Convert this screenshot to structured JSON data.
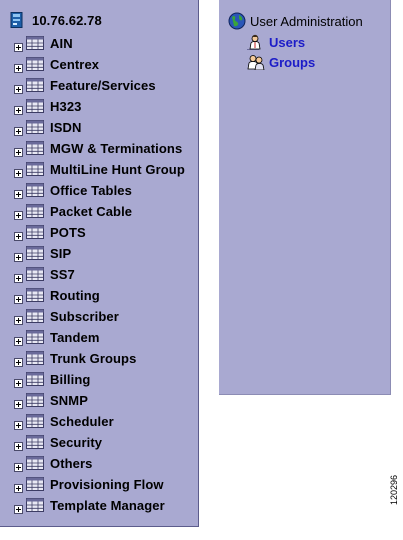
{
  "tree": {
    "root_label": "10.76.62.78",
    "items": [
      {
        "label": "AIN"
      },
      {
        "label": "Centrex"
      },
      {
        "label": "Feature/Services"
      },
      {
        "label": "H323"
      },
      {
        "label": "ISDN"
      },
      {
        "label": "MGW & Terminations"
      },
      {
        "label": "MultiLine Hunt Group"
      },
      {
        "label": "Office Tables"
      },
      {
        "label": "Packet Cable"
      },
      {
        "label": "POTS"
      },
      {
        "label": "SIP"
      },
      {
        "label": "SS7"
      },
      {
        "label": "Routing"
      },
      {
        "label": "Subscriber"
      },
      {
        "label": "Tandem"
      },
      {
        "label": "Trunk Groups"
      },
      {
        "label": "Billing"
      },
      {
        "label": "SNMP"
      },
      {
        "label": "Scheduler"
      },
      {
        "label": "Security"
      },
      {
        "label": "Others"
      },
      {
        "label": "Provisioning Flow"
      },
      {
        "label": "Template Manager"
      }
    ]
  },
  "user_admin": {
    "title": "User Administration",
    "links": [
      {
        "label": "Users",
        "icon": "user-icon"
      },
      {
        "label": "Groups",
        "icon": "group-icon"
      }
    ]
  },
  "figure_id": "120296",
  "colors": {
    "panel_bg": "#a9a9d1",
    "link": "#1c1cc8",
    "folder": "#6a6a9a"
  }
}
